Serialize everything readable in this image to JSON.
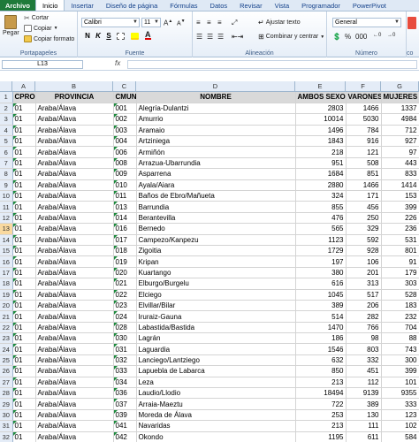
{
  "tabs": [
    "Archivo",
    "Inicio",
    "Insertar",
    "Diseño de página",
    "Fórmulas",
    "Datos",
    "Revisar",
    "Vista",
    "Programador",
    "PowerPivot"
  ],
  "ribbon": {
    "clipboard": {
      "paste": "Pegar",
      "cut": "Cortar",
      "copy": "Copiar",
      "copy_format": "Copiar formato",
      "label": "Portapapeles"
    },
    "font": {
      "name": "Calibri",
      "size": "11",
      "bold": "N",
      "italic": "K",
      "underline": "S",
      "label": "Fuente"
    },
    "alignment": {
      "wrap": "Ajustar texto",
      "merge": "Combinar y centrar",
      "label": "Alineación"
    },
    "number": {
      "format": "General",
      "label": "Número"
    },
    "styles_label": "co"
  },
  "formula_bar": {
    "name_box": "L13",
    "fx": "fx",
    "content": ""
  },
  "colors": {
    "file_tab": "#1f7a3a",
    "header_fill": "#d9d9d9",
    "selected_row": "#f9d99f"
  },
  "columns": [
    "A",
    "B",
    "C",
    "D",
    "E",
    "F",
    "G"
  ],
  "headers": [
    "CPRO",
    "PROVINCIA",
    "CMUN",
    "NOMBRE",
    "AMBOS SEXOS",
    "VARONES",
    "MUJERES"
  ],
  "rows": [
    [
      "01",
      "Araba/Álava",
      "001",
      "Alegría-Dulantzi",
      "2803",
      "1466",
      "1337"
    ],
    [
      "01",
      "Araba/Álava",
      "002",
      "Amurrio",
      "10014",
      "5030",
      "4984"
    ],
    [
      "01",
      "Araba/Álava",
      "003",
      "Aramaio",
      "1496",
      "784",
      "712"
    ],
    [
      "01",
      "Araba/Álava",
      "004",
      "Artziniega",
      "1843",
      "916",
      "927"
    ],
    [
      "01",
      "Araba/Álava",
      "006",
      "Armiñón",
      "218",
      "121",
      "97"
    ],
    [
      "01",
      "Araba/Álava",
      "008",
      "Arrazua-Ubarrundia",
      "951",
      "508",
      "443"
    ],
    [
      "01",
      "Araba/Álava",
      "009",
      "Asparrena",
      "1684",
      "851",
      "833"
    ],
    [
      "01",
      "Araba/Álava",
      "010",
      "Ayala/Aiara",
      "2880",
      "1466",
      "1414"
    ],
    [
      "01",
      "Araba/Álava",
      "011",
      "Baños de Ebro/Mañueta",
      "324",
      "171",
      "153"
    ],
    [
      "01",
      "Araba/Álava",
      "013",
      "Barrundia",
      "855",
      "456",
      "399"
    ],
    [
      "01",
      "Araba/Álava",
      "014",
      "Berantevilla",
      "476",
      "250",
      "226"
    ],
    [
      "01",
      "Araba/Álava",
      "016",
      "Bernedo",
      "565",
      "329",
      "236"
    ],
    [
      "01",
      "Araba/Álava",
      "017",
      "Campezo/Kanpezu",
      "1123",
      "592",
      "531"
    ],
    [
      "01",
      "Araba/Álava",
      "018",
      "Zigoitia",
      "1729",
      "928",
      "801"
    ],
    [
      "01",
      "Araba/Álava",
      "019",
      "Kripan",
      "197",
      "106",
      "91"
    ],
    [
      "01",
      "Araba/Álava",
      "020",
      "Kuartango",
      "380",
      "201",
      "179"
    ],
    [
      "01",
      "Araba/Álava",
      "021",
      "Elburgo/Burgelu",
      "616",
      "313",
      "303"
    ],
    [
      "01",
      "Araba/Álava",
      "022",
      "Elciego",
      "1045",
      "517",
      "528"
    ],
    [
      "01",
      "Araba/Álava",
      "023",
      "Elvillar/Bilar",
      "389",
      "206",
      "183"
    ],
    [
      "01",
      "Araba/Álava",
      "024",
      "Iruraiz-Gauna",
      "514",
      "282",
      "232"
    ],
    [
      "01",
      "Araba/Álava",
      "028",
      "Labastida/Bastida",
      "1470",
      "766",
      "704"
    ],
    [
      "01",
      "Araba/Álava",
      "030",
      "Lagrán",
      "186",
      "98",
      "88"
    ],
    [
      "01",
      "Araba/Álava",
      "031",
      "Laguardia",
      "1546",
      "803",
      "743"
    ],
    [
      "01",
      "Araba/Álava",
      "032",
      "Lanciego/Lantziego",
      "632",
      "332",
      "300"
    ],
    [
      "01",
      "Araba/Álava",
      "033",
      "Lapuebla de Labarca",
      "850",
      "451",
      "399"
    ],
    [
      "01",
      "Araba/Álava",
      "034",
      "Leza",
      "213",
      "112",
      "101"
    ],
    [
      "01",
      "Araba/Álava",
      "036",
      "Laudio/Llodio",
      "18494",
      "9139",
      "9355"
    ],
    [
      "01",
      "Araba/Álava",
      "037",
      "Arraia-Maeztu",
      "722",
      "389",
      "333"
    ],
    [
      "01",
      "Araba/Álava",
      "039",
      "Moreda de Álava",
      "253",
      "130",
      "123"
    ],
    [
      "01",
      "Araba/Álava",
      "041",
      "Navaridas",
      "213",
      "111",
      "102"
    ],
    [
      "01",
      "Araba/Álava",
      "042",
      "Okondo",
      "1195",
      "611",
      "584"
    ]
  ],
  "selected_row": 13
}
